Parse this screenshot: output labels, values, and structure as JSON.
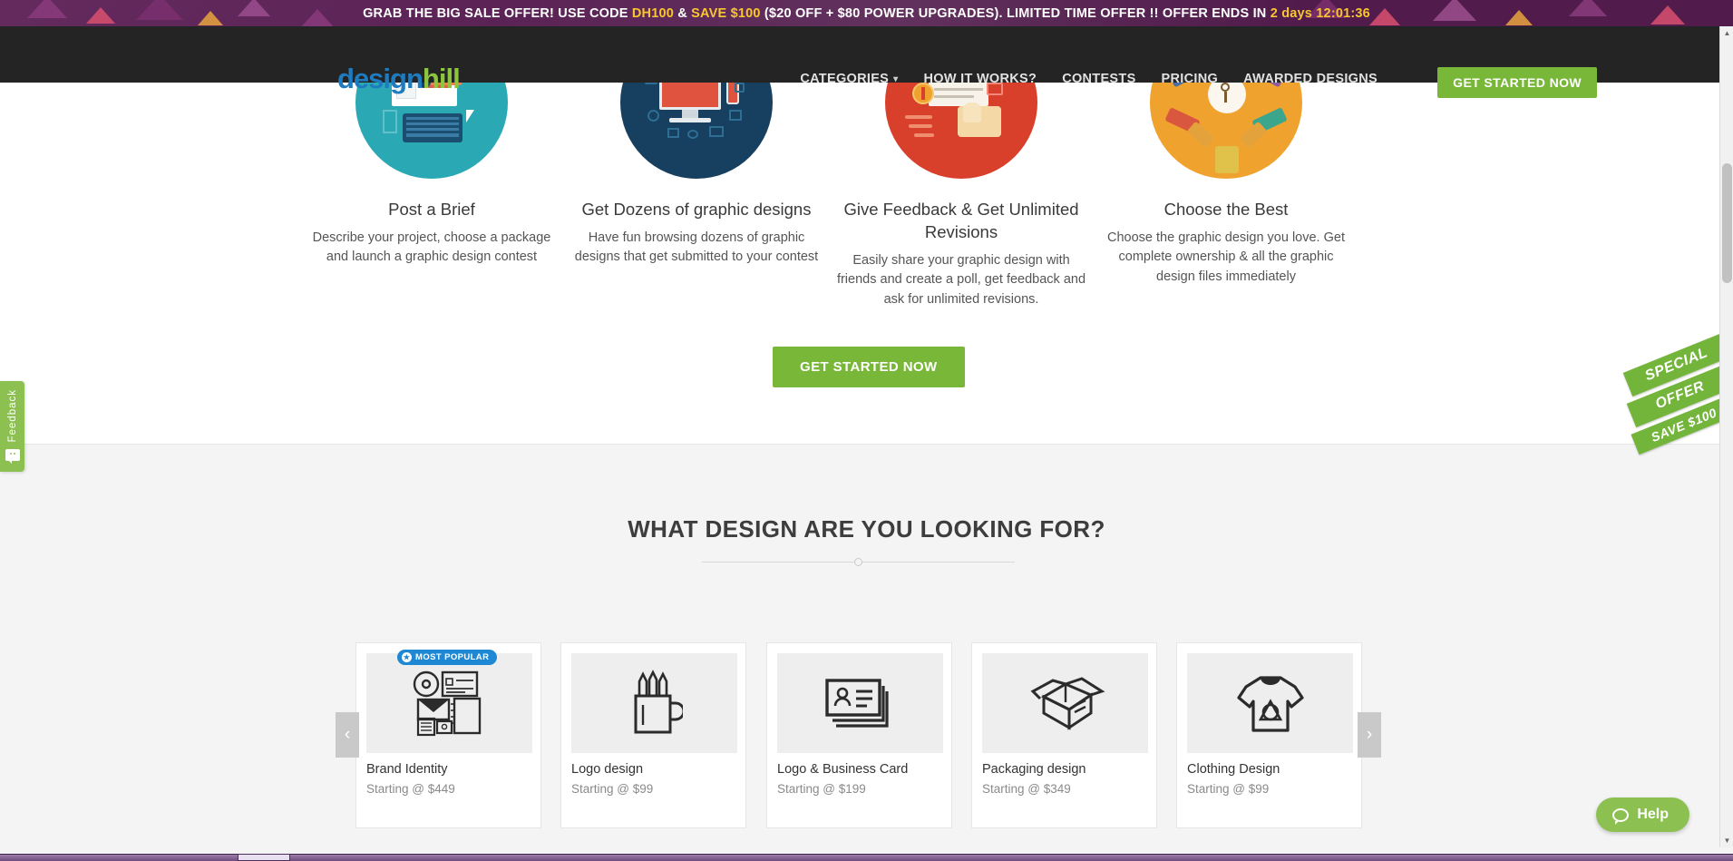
{
  "promo": {
    "text_before_code": "GRAB THE BIG SALE OFFER! USE CODE ",
    "code": "DH100",
    "amp": " & ",
    "save": "SAVE $100",
    "text_middle": " ($20 OFF + $80 POWER UPGRADES). LIMITED TIME OFFER !! OFFER ENDS IN ",
    "countdown": "2 days 12:01:36"
  },
  "header": {
    "logo_first": "design",
    "logo_second": "hill",
    "nav": [
      {
        "label": "CATEGORIES",
        "has_caret": true,
        "caret": "▾"
      },
      {
        "label": "HOW IT WORKS?",
        "has_caret": false
      },
      {
        "label": "CONTESTS",
        "has_caret": false
      },
      {
        "label": "PRICING",
        "has_caret": false
      },
      {
        "label": "AWARDED DESIGNS",
        "has_caret": false
      }
    ],
    "cta_label": "GET STARTED NOW"
  },
  "steps": [
    {
      "title": "Post a Brief",
      "desc": "Describe your project, choose a package and launch a graphic design contest",
      "circle_color": "#2aa9b5"
    },
    {
      "title": "Get Dozens of graphic designs",
      "desc": "Have fun browsing dozens of graphic designs that get submitted to your contest",
      "circle_color": "#173f5f"
    },
    {
      "title": "Give Feedback & Get Unlimited Revisions",
      "desc": "Easily share your graphic design with friends and create a poll, get feedback and ask for unlimited revisions.",
      "circle_color": "#d9402b"
    },
    {
      "title": "Choose the Best",
      "desc": "Choose the graphic design you love. Get complete ownership & all the graphic design files immediately",
      "circle_color": "#f0a22e"
    }
  ],
  "mid_cta_label": "GET STARTED NOW",
  "lower": {
    "title": "WHAT DESIGN ARE YOU LOOKING FOR?"
  },
  "carousel": {
    "prev_label": "‹",
    "next_label": "›",
    "badge_label": "MOST POPULAR",
    "badge_star": "★",
    "cards": [
      {
        "name": "Brand Identity",
        "price": "Starting @ $449",
        "icon": "brand-identity-icon",
        "badge": true
      },
      {
        "name": "Logo design",
        "price": "Starting @ $99",
        "icon": "pencil-cup-icon",
        "badge": false
      },
      {
        "name": "Logo & Business Card",
        "price": "Starting @ $199",
        "icon": "business-card-icon",
        "badge": false
      },
      {
        "name": "Packaging design",
        "price": "Starting @ $349",
        "icon": "open-box-icon",
        "badge": false
      },
      {
        "name": "Clothing Design",
        "price": "Starting @ $99",
        "icon": "tshirt-icon",
        "badge": false
      }
    ]
  },
  "feedback": {
    "label": "Feedback"
  },
  "ribbon": {
    "line1": "SPECIAL",
    "line2": "OFFER",
    "line3": "SAVE $100"
  },
  "help": {
    "label": "Help"
  },
  "scrollbar": {
    "up": "▲",
    "down": "▼"
  },
  "colors": {
    "promo_bg": "#5c1f56",
    "header_bg": "#242424",
    "accent_green": "#78b737",
    "accent_blue": "#1e7bc0",
    "logo_green": "#8cc63f",
    "badge_blue": "#1e88d4",
    "yellow": "#f7c631"
  }
}
